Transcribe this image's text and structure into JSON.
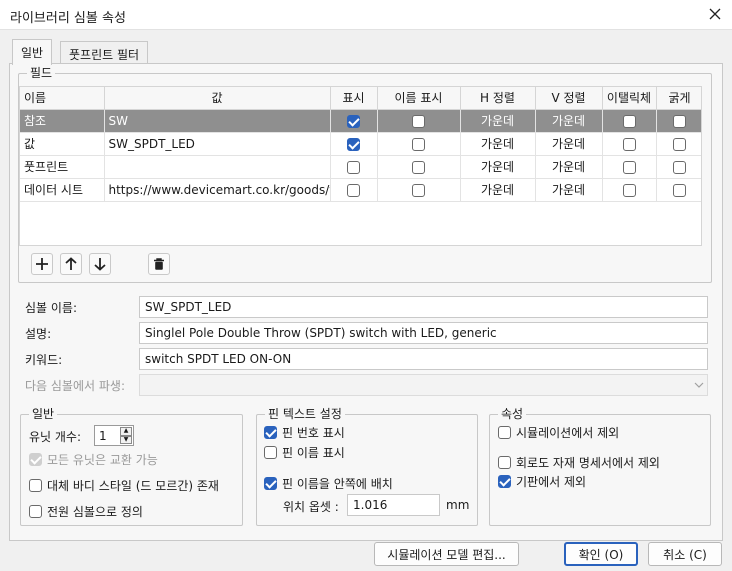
{
  "window": {
    "title": "라이브러리 심볼 속성"
  },
  "tabs": [
    {
      "label": "일반",
      "active": true
    },
    {
      "label": "풋프린트 필터",
      "active": false
    }
  ],
  "fields_group": {
    "label": "필드",
    "columns": [
      "이름",
      "값",
      "표시",
      "이름 표시",
      "H 정렬",
      "V 정렬",
      "이탤릭체",
      "굵게"
    ],
    "rows": [
      {
        "name": "참조",
        "value": "SW",
        "show": true,
        "show_name": false,
        "h_align": "가운데",
        "v_align": "가운데",
        "italic": false,
        "bold": false,
        "selected": true
      },
      {
        "name": "값",
        "value": "SW_SPDT_LED",
        "show": true,
        "show_name": false,
        "h_align": "가운데",
        "v_align": "가운데",
        "italic": false,
        "bold": false,
        "selected": false
      },
      {
        "name": "풋프린트",
        "value": "",
        "show": false,
        "show_name": false,
        "h_align": "가운데",
        "v_align": "가운데",
        "italic": false,
        "bold": false,
        "selected": false
      },
      {
        "name": "데이터 시트",
        "value": "https://www.devicemart.co.kr/goods/view",
        "show": false,
        "show_name": false,
        "h_align": "가운데",
        "v_align": "가운데",
        "italic": false,
        "bold": false,
        "selected": false
      }
    ],
    "toolbar_icons": [
      "add-icon",
      "move-up-icon",
      "move-down-icon",
      "trash-icon"
    ]
  },
  "symbol_name": {
    "label": "심볼 이름:",
    "value": "SW_SPDT_LED"
  },
  "description": {
    "label": "설명:",
    "value": "Singlel Pole Double Throw (SPDT) switch with LED, generic"
  },
  "keywords": {
    "label": "키워드:",
    "value": "switch SPDT LED ON-ON"
  },
  "derive_from": {
    "label": "다음 심볼에서 파생:",
    "value": ""
  },
  "general_group": {
    "label": "일반",
    "units_label": "유닛 개수:",
    "units_value": "1",
    "interchangeable": {
      "label": "모든 유닛은 교환 가능",
      "checked": true,
      "disabled": true
    },
    "alt_body": {
      "label": "대체 바디 스타일 (드 모르간) 존재",
      "checked": false
    },
    "power_symbol": {
      "label": "전원 심볼으로 정의",
      "checked": false
    }
  },
  "pin_text_group": {
    "label": "핀 텍스트 설정",
    "show_pin_number": {
      "label": "핀 번호 표시",
      "checked": true
    },
    "show_pin_name": {
      "label": "핀 이름 표시",
      "checked": false
    },
    "pin_names_inside": {
      "label": "핀 이름을 안쪽에 배치",
      "checked": true
    },
    "offset_label": "위치 옵셋 :",
    "offset_value": "1.016",
    "offset_unit": "mm"
  },
  "attributes_group": {
    "label": "속성",
    "exclude_sim": {
      "label": "시뮬레이션에서 제외",
      "checked": false
    },
    "exclude_bom": {
      "label": "회로도 자재 명세서에서 제외",
      "checked": false
    },
    "exclude_board": {
      "label": "기판에서 제외",
      "checked": true
    }
  },
  "buttons": {
    "sim_model": "시뮬레이션 모델 편집...",
    "ok": "확인 (O)",
    "cancel": "취소 (C)"
  },
  "colors": {
    "accent": "#2a62bd",
    "selected_row": "#8f8f8f"
  }
}
